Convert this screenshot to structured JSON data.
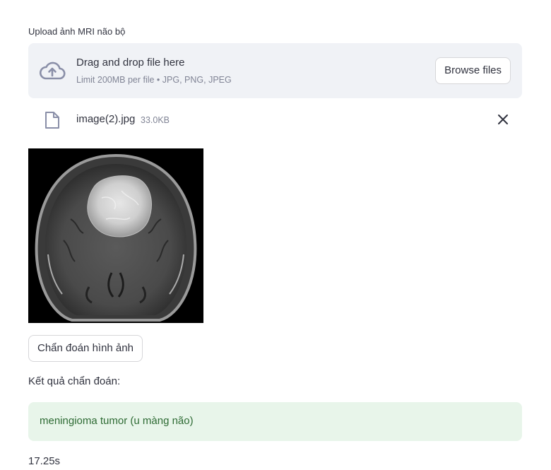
{
  "uploader": {
    "label": "Upload ảnh MRI não bộ",
    "drop_title": "Drag and drop file here",
    "drop_subtitle": "Limit 200MB per file • JPG, PNG, JPEG",
    "browse_label": "Browse files",
    "icon": "cloud-upload-icon"
  },
  "uploaded_file": {
    "name": "image(2).jpg",
    "size": "33.0KB",
    "icon": "file-icon",
    "remove_icon": "close-icon"
  },
  "actions": {
    "diagnose_label": "Chẩn đoán hình ảnh"
  },
  "result": {
    "label": "Kết quả chẩn đoán:",
    "value": "meningioma tumor (u màng não)",
    "elapsed": "17.25s"
  },
  "colors": {
    "accent_bg": "#f0f2f6",
    "success_bg": "#e8f5ea",
    "success_text": "#2e6b34",
    "muted_text": "#808495"
  }
}
